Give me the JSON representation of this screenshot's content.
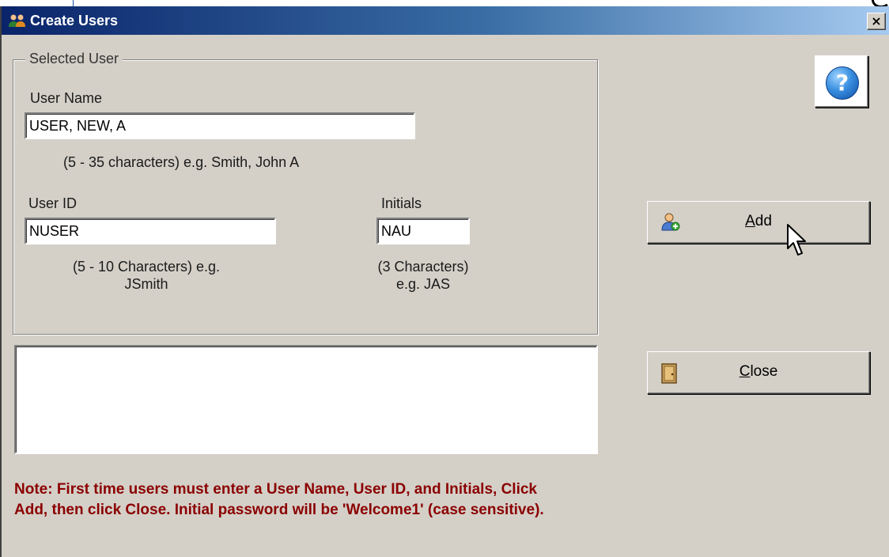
{
  "window": {
    "title": "Create Users",
    "close_glyph": "×",
    "icon": "users-icon"
  },
  "group": {
    "legend": "Selected User",
    "user_name": {
      "label": "User Name",
      "value": "USER, NEW, A",
      "hint": "(5 - 35 characters) e.g. Smith, John A"
    },
    "user_id": {
      "label": "User ID",
      "value": "NUSER",
      "hint_line1": "(5 - 10 Characters) e.g.",
      "hint_line2": "JSmith"
    },
    "initials": {
      "label": "Initials",
      "value": "NAU",
      "hint_line1": "(3 Characters)",
      "hint_line2": "e.g. JAS"
    }
  },
  "buttons": {
    "help": {
      "glyph": "?",
      "icon": "help-icon"
    },
    "add": {
      "label_access": "A",
      "label_rest": "dd",
      "icon": "add-user-icon"
    },
    "close": {
      "label_access": "C",
      "label_rest": "lose",
      "icon": "door-icon"
    }
  },
  "message_box": {
    "text": ""
  },
  "note": {
    "line1": "Note: First time users must enter a User Name, User ID, and Initials, Click",
    "line2": "Add, then click Close. Initial password will be 'Welcome1' (case sensitive)."
  },
  "colors": {
    "titlebar_start": "#0a246a",
    "titlebar_end": "#a6caf0",
    "note_text": "#8b0000",
    "dialog_bg": "#d4d0c8"
  }
}
